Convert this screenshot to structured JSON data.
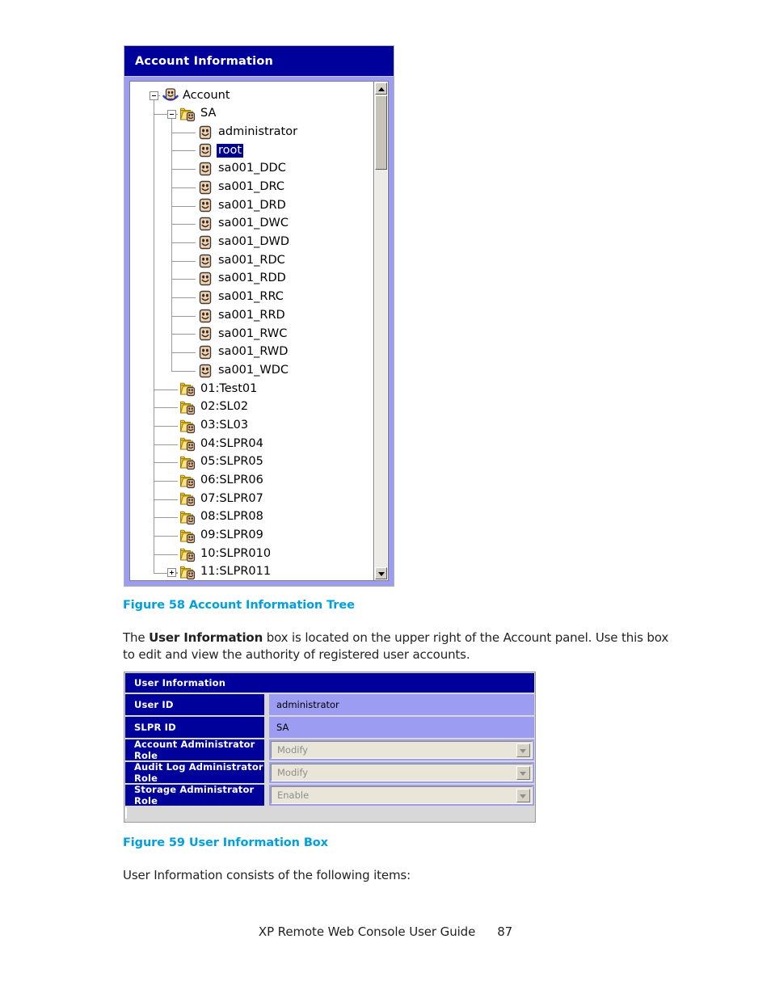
{
  "figure58": {
    "panel_title": "Account Information",
    "title_color": "#00009a",
    "selected_node": "root",
    "tree": [
      {
        "label": "Account",
        "icon": "user-root-icon",
        "depth": 0,
        "expander": "minus",
        "selected": false
      },
      {
        "label": "SA",
        "icon": "folder-user-icon",
        "depth": 1,
        "expander": "minus",
        "selected": false
      },
      {
        "label": "administrator",
        "icon": "user-icon",
        "depth": 2,
        "expander": "none",
        "selected": false
      },
      {
        "label": "root",
        "icon": "user-icon",
        "depth": 2,
        "expander": "none",
        "selected": true
      },
      {
        "label": "sa001_DDC",
        "icon": "user-icon",
        "depth": 2,
        "expander": "none",
        "selected": false
      },
      {
        "label": "sa001_DRC",
        "icon": "user-icon",
        "depth": 2,
        "expander": "none",
        "selected": false
      },
      {
        "label": "sa001_DRD",
        "icon": "user-icon",
        "depth": 2,
        "expander": "none",
        "selected": false
      },
      {
        "label": "sa001_DWC",
        "icon": "user-icon",
        "depth": 2,
        "expander": "none",
        "selected": false
      },
      {
        "label": "sa001_DWD",
        "icon": "user-icon",
        "depth": 2,
        "expander": "none",
        "selected": false
      },
      {
        "label": "sa001_RDC",
        "icon": "user-icon",
        "depth": 2,
        "expander": "none",
        "selected": false
      },
      {
        "label": "sa001_RDD",
        "icon": "user-icon",
        "depth": 2,
        "expander": "none",
        "selected": false
      },
      {
        "label": "sa001_RRC",
        "icon": "user-icon",
        "depth": 2,
        "expander": "none",
        "selected": false
      },
      {
        "label": "sa001_RRD",
        "icon": "user-icon",
        "depth": 2,
        "expander": "none",
        "selected": false
      },
      {
        "label": "sa001_RWC",
        "icon": "user-icon",
        "depth": 2,
        "expander": "none",
        "selected": false
      },
      {
        "label": "sa001_RWD",
        "icon": "user-icon",
        "depth": 2,
        "expander": "none",
        "selected": false
      },
      {
        "label": "sa001_WDC",
        "icon": "user-icon",
        "depth": 2,
        "expander": "none",
        "selected": false
      },
      {
        "label": "01:Test01",
        "icon": "folder-user-icon",
        "depth": 1,
        "expander": "none",
        "selected": false
      },
      {
        "label": "02:SL02",
        "icon": "folder-user-icon",
        "depth": 1,
        "expander": "none",
        "selected": false
      },
      {
        "label": "03:SL03",
        "icon": "folder-user-icon",
        "depth": 1,
        "expander": "none",
        "selected": false
      },
      {
        "label": "04:SLPR04",
        "icon": "folder-user-icon",
        "depth": 1,
        "expander": "none",
        "selected": false
      },
      {
        "label": "05:SLPR05",
        "icon": "folder-user-icon",
        "depth": 1,
        "expander": "none",
        "selected": false
      },
      {
        "label": "06:SLPR06",
        "icon": "folder-user-icon",
        "depth": 1,
        "expander": "none",
        "selected": false
      },
      {
        "label": "07:SLPR07",
        "icon": "folder-user-icon",
        "depth": 1,
        "expander": "none",
        "selected": false
      },
      {
        "label": "08:SLPR08",
        "icon": "folder-user-icon",
        "depth": 1,
        "expander": "none",
        "selected": false
      },
      {
        "label": "09:SLPR09",
        "icon": "folder-user-icon",
        "depth": 1,
        "expander": "none",
        "selected": false
      },
      {
        "label": "10:SLPR010",
        "icon": "folder-user-icon",
        "depth": 1,
        "expander": "none",
        "selected": false
      },
      {
        "label": "11:SLPR011",
        "icon": "folder-user-icon",
        "depth": 1,
        "expander": "plus",
        "selected": false
      }
    ],
    "scrollbar": {
      "up_arrow": "scroll-up-arrow-icon",
      "down_arrow": "scroll-down-arrow-icon"
    },
    "caption": "Figure 58 Account Information Tree",
    "caption_color": "#00a0dd"
  },
  "paragraph1": {
    "part1": "The ",
    "bold": "User Information",
    "part2": " box is located on the upper right of the Account panel. Use this box to edit and view the authority of registered user accounts."
  },
  "figure59": {
    "box_title": "User Information",
    "rows": [
      {
        "label": "User ID",
        "type": "text",
        "value": "administrator"
      },
      {
        "label": "SLPR ID",
        "type": "text",
        "value": "SA"
      },
      {
        "label": "Account Administrator Role",
        "type": "select",
        "value": "Modify"
      },
      {
        "label": "Audit Log Administrator Role",
        "type": "select",
        "value": "Modify"
      },
      {
        "label": "Storage Administrator Role",
        "type": "select",
        "value": "Enable"
      }
    ],
    "caption": "Figure 59 User Information Box",
    "caption_color": "#00a0dd"
  },
  "paragraph2": {
    "text": "User Information consists of the following items:"
  },
  "footer": {
    "title": "XP Remote Web Console User Guide",
    "page": "87"
  }
}
